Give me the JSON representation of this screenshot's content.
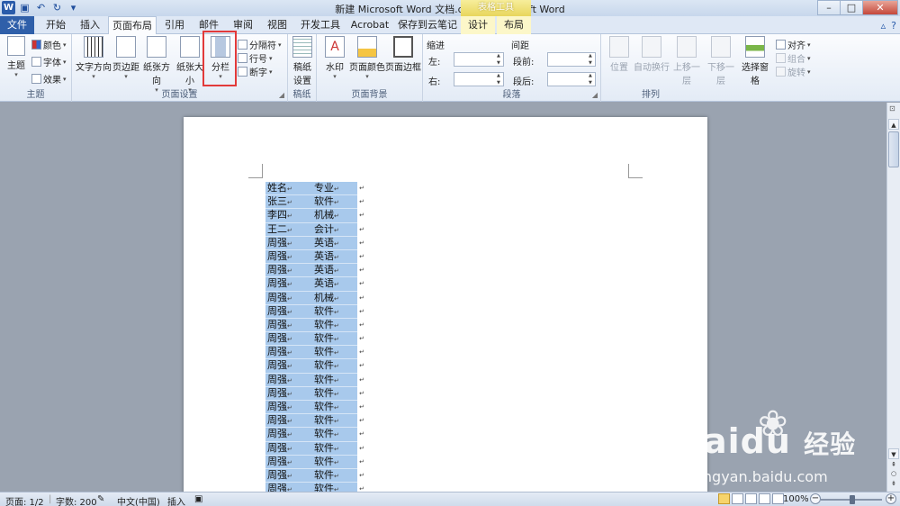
{
  "window": {
    "title": "新建 Microsoft Word 文档.docx - Microsoft Word",
    "context_tab_header": "表格工具",
    "controls": [
      "–",
      "□",
      "✕"
    ]
  },
  "quick_access": {
    "app_icon": "W",
    "save_icon": "save-icon",
    "undo_icon": "undo-icon",
    "redo_icon": "redo-icon"
  },
  "tabs": [
    {
      "label": "文件"
    },
    {
      "label": "开始"
    },
    {
      "label": "插入"
    },
    {
      "label": "页面布局"
    },
    {
      "label": "引用"
    },
    {
      "label": "邮件"
    },
    {
      "label": "审阅"
    },
    {
      "label": "视图"
    },
    {
      "label": "开发工具"
    },
    {
      "label": "Acrobat"
    },
    {
      "label": "保存到云笔记"
    },
    {
      "label": "设计"
    },
    {
      "label": "布局"
    }
  ],
  "active_tab": "页面布局",
  "ribbon": {
    "theme_group": {
      "label": "主题",
      "theme_btn": "主题",
      "colors": "颜色",
      "fonts": "字体",
      "effects": "效果"
    },
    "page_setup_group": {
      "label": "页面设置",
      "text_direction": "文字方向",
      "margins": "页边距",
      "orientation": "纸张方向",
      "size": "纸张大小",
      "columns": "分栏",
      "breaks": "分隔符",
      "line_numbers": "行号",
      "hyphenation": "断字"
    },
    "manuscript_group": {
      "label": "稿纸",
      "setup_line1": "稿纸",
      "setup_line2": "设置"
    },
    "page_background_group": {
      "label": "页面背景",
      "watermark": "水印",
      "page_color": "页面颜色",
      "page_borders": "页面边框"
    },
    "paragraph_group": {
      "label": "段落",
      "indent_title": "缩进",
      "spacing_title": "间距",
      "left": "左:",
      "right": "右:",
      "before": "段前:",
      "after": "段后:"
    },
    "arrange_group": {
      "label": "排列",
      "position": "位置",
      "wrap_text": "自动换行",
      "bring_forward": "上移一层",
      "send_backward": "下移一层",
      "selection_pane": "选择窗格",
      "align": "对齐",
      "group": "组合",
      "rotate": "旋转"
    }
  },
  "document": {
    "paragraph_mark": "↵",
    "rows": [
      [
        "姓名",
        "专业"
      ],
      [
        "张三",
        "软件"
      ],
      [
        "李四",
        "机械"
      ],
      [
        "王二",
        "会计"
      ],
      [
        "周强",
        "英语"
      ],
      [
        "周强",
        "英语"
      ],
      [
        "周强",
        "英语"
      ],
      [
        "周强",
        "英语"
      ],
      [
        "周强",
        "机械"
      ],
      [
        "周强",
        "软件"
      ],
      [
        "周强",
        "软件"
      ],
      [
        "周强",
        "软件"
      ],
      [
        "周强",
        "软件"
      ],
      [
        "周强",
        "软件"
      ],
      [
        "周强",
        "软件"
      ],
      [
        "周强",
        "软件"
      ],
      [
        "周强",
        "软件"
      ],
      [
        "周强",
        "软件"
      ],
      [
        "周强",
        "软件"
      ],
      [
        "周强",
        "软件"
      ],
      [
        "周强",
        "软件"
      ],
      [
        "周强",
        "软件"
      ],
      [
        "周强",
        "软件"
      ],
      [
        "周强",
        "软件"
      ]
    ]
  },
  "statusbar": {
    "page": "页面: 1/2",
    "words": "字数: 200",
    "language": "中文(中国)",
    "mode": "插入",
    "zoom": "100%"
  },
  "watermark": {
    "brand": "Baidu",
    "brand_cn": "经验",
    "url": "jingyan.baidu.com"
  },
  "colors": {
    "file_tab": "#2f5fa9",
    "selection": "#a8c9ec",
    "highlight_box": "#e23a3a",
    "context_tab": "#e8d65c"
  }
}
